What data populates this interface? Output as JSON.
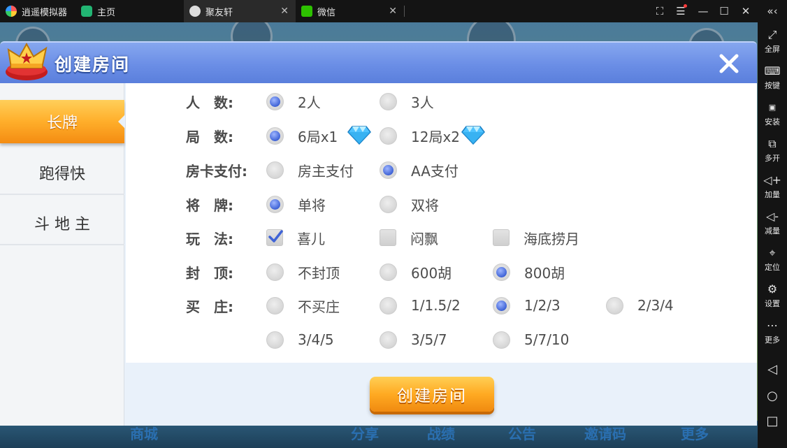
{
  "emulator": {
    "app_name": "逍遥模拟器",
    "tabs": [
      {
        "label": "主页"
      },
      {
        "label": "聚友轩"
      },
      {
        "label": "微信"
      }
    ],
    "sidebar": [
      {
        "label": "全屏",
        "icon": "fullscreen-icon"
      },
      {
        "label": "按键",
        "icon": "keyboard-icon"
      },
      {
        "label": "安装",
        "icon": "apk-install-icon"
      },
      {
        "label": "多开",
        "icon": "multi-instance-icon"
      },
      {
        "label": "加量",
        "icon": "volume-up-icon"
      },
      {
        "label": "减量",
        "icon": "volume-down-icon"
      },
      {
        "label": "定位",
        "icon": "location-icon"
      },
      {
        "label": "设置",
        "icon": "gear-icon"
      },
      {
        "label": "更多",
        "icon": "more-icon"
      }
    ]
  },
  "background": {
    "bottom_nav": [
      "商城",
      "分享",
      "战绩",
      "公告",
      "邀请码",
      "更多"
    ]
  },
  "dialog": {
    "title": "创建房间",
    "menu": [
      {
        "label": "长牌",
        "active": true
      },
      {
        "label": "跑得快",
        "active": false
      },
      {
        "label": "斗 地 主",
        "active": false
      }
    ],
    "options": {
      "players": {
        "label": "人　数:",
        "choices": [
          {
            "text": "2人",
            "selected": true
          },
          {
            "text": "3人",
            "selected": false
          }
        ]
      },
      "rounds": {
        "label": "局　数:",
        "choices": [
          {
            "text": "6局x1",
            "selected": true
          },
          {
            "text": "12局x2",
            "selected": false
          }
        ]
      },
      "payment": {
        "label": "房卡支付:",
        "choices": [
          {
            "text": "房主支付",
            "selected": false
          },
          {
            "text": "AA支付",
            "selected": true
          }
        ]
      },
      "general": {
        "label": "将　牌:",
        "choices": [
          {
            "text": "单将",
            "selected": true
          },
          {
            "text": "双将",
            "selected": false
          }
        ]
      },
      "play": {
        "label": "玩　法:",
        "choices": [
          {
            "text": "喜儿",
            "checked": true
          },
          {
            "text": "闷飘",
            "checked": false
          },
          {
            "text": "海底捞月",
            "checked": false
          }
        ]
      },
      "cap": {
        "label": "封　顶:",
        "choices": [
          {
            "text": "不封顶",
            "selected": false
          },
          {
            "text": "600胡",
            "selected": false
          },
          {
            "text": "800胡",
            "selected": true
          }
        ]
      },
      "banker": {
        "label": "买　庄:",
        "choices": [
          {
            "text": "不买庄",
            "selected": false
          },
          {
            "text": "1/1.5/2",
            "selected": false
          },
          {
            "text": "1/2/3",
            "selected": true
          },
          {
            "text": "2/3/4",
            "selected": false
          },
          {
            "text": "3/4/5",
            "selected": false
          },
          {
            "text": "3/5/7",
            "selected": false
          },
          {
            "text": "5/7/10",
            "selected": false
          }
        ]
      }
    },
    "create_button": "创建房间",
    "colors": {
      "header": "#6b8ee6",
      "accent_orange": "#ffae2a",
      "radio_selected": "#3f63d6"
    }
  }
}
